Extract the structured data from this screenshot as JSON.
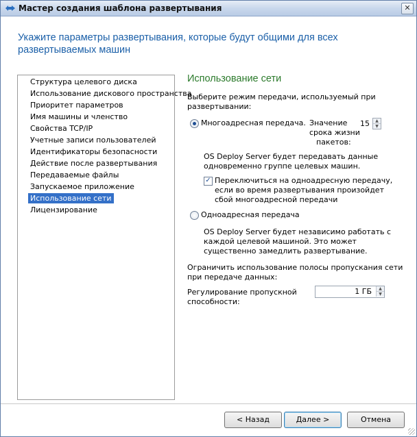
{
  "window": {
    "title": "Мастер создания шаблона развертывания",
    "close_glyph": "✕"
  },
  "header": {
    "text": "Укажите параметры развертывания, которые будут общими для всех развертываемых машин"
  },
  "sidebar": {
    "items": [
      {
        "label": "Структура целевого диска",
        "selected": false
      },
      {
        "label": "Использование дискового пространства",
        "selected": false
      },
      {
        "label": "Приоритет параметров",
        "selected": false
      },
      {
        "label": "Имя машины и членство",
        "selected": false
      },
      {
        "label": "Свойства TCP/IP",
        "selected": false
      },
      {
        "label": "Учетные записи пользователей",
        "selected": false
      },
      {
        "label": "Идентификаторы безопасности",
        "selected": false
      },
      {
        "label": "Действие после развертывания",
        "selected": false
      },
      {
        "label": "Передаваемые файлы",
        "selected": false
      },
      {
        "label": "Запускаемое приложение",
        "selected": false
      },
      {
        "label": "Использование сети",
        "selected": true
      },
      {
        "label": "Лицензирование",
        "selected": false
      }
    ]
  },
  "main": {
    "section_title": "Использование сети",
    "mode_prompt_1": "Выберите режим передачи, используемый при",
    "mode_prompt_2": "развертывании:",
    "multicast": {
      "label": "Многоадресная передача.",
      "selected": true,
      "ttl_label_1": "Значение",
      "ttl_label_2": "срока жизни",
      "ttl_label_3": "пакетов:",
      "ttl_value": "15",
      "desc_1": "OS Deploy Server будет передавать данные",
      "desc_2": "одновременно группе целевых машин.",
      "fallback_checked": true,
      "fallback_1": "Переключиться на одноадресную передачу,",
      "fallback_2": "если во время развертывания произойдет",
      "fallback_3": "сбой многоадресной передачи"
    },
    "unicast": {
      "label": "Одноадресная передача",
      "selected": false,
      "desc_1": "OS Deploy Server будет независимо работать с",
      "desc_2": "каждой целевой машиной. Это может",
      "desc_3": "существенно замедлить развертывание."
    },
    "bandwidth": {
      "prompt_1": "Ограничить использование полосы пропускания сети",
      "prompt_2": "при передаче данных:",
      "label_1": "Регулирование пропускной",
      "label_2": "способности:",
      "value": "1 ГБ"
    }
  },
  "buttons": {
    "back": "< Назад",
    "next": "Далее >",
    "cancel": "Отмена"
  }
}
